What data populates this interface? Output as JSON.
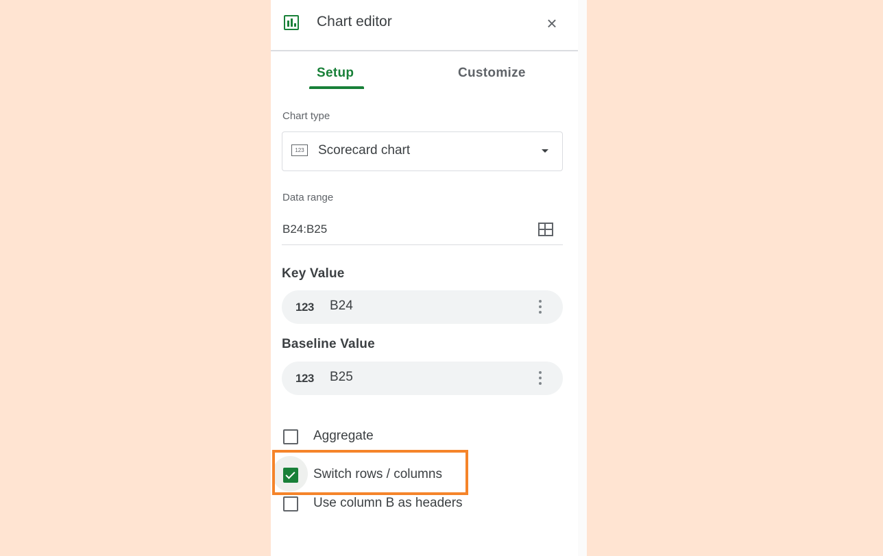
{
  "header": {
    "title": "Chart editor",
    "icon": "bar-chart-icon",
    "close_icon": "close-icon"
  },
  "tabs": [
    {
      "label": "Setup",
      "active": true
    },
    {
      "label": "Customize",
      "active": false
    }
  ],
  "chart_type": {
    "label": "Chart type",
    "value": "Scorecard chart",
    "icon_text": "123"
  },
  "data_range": {
    "label": "Data range",
    "value": "B24:B25"
  },
  "key_value": {
    "label": "Key Value",
    "icon_text": "123",
    "value": "B24"
  },
  "baseline_value": {
    "label": "Baseline Value",
    "icon_text": "123",
    "value": "B25"
  },
  "options": [
    {
      "label": "Aggregate",
      "checked": false
    },
    {
      "label": "Switch rows / columns",
      "checked": true
    },
    {
      "label": "Use column B as headers",
      "checked": false
    }
  ],
  "colors": {
    "accent": "#188038",
    "highlight": "#f5842a",
    "background": "#ffe4d2"
  }
}
